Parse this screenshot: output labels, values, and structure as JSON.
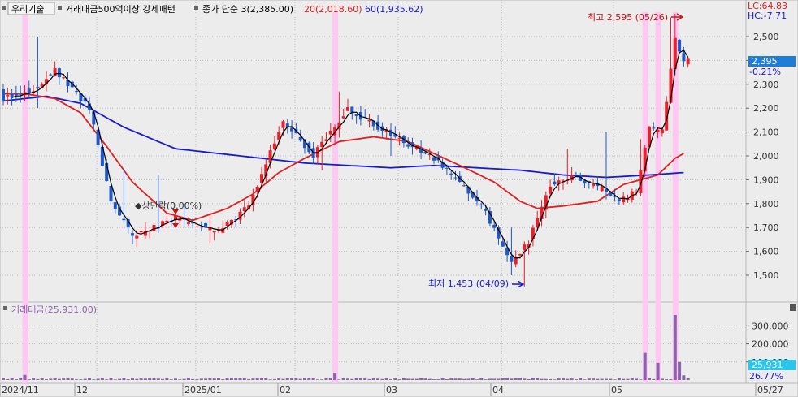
{
  "header": {
    "stock_name": "우리기술",
    "study_name": "거래대금500억이상 강세패턴",
    "close_label": "종가 단순 3(2,385.00)",
    "ma20_label": "20(2,018.60)",
    "ma60_label": "60(1,935.62)"
  },
  "lc_label": "LC:64.83",
  "hc_label": "HC:-7.71",
  "annotations": {
    "high": "최고 2,595 (05/26)",
    "low": "최저 1,453 (04/09)",
    "marker": "◆상단락(0.00%)"
  },
  "current": {
    "price": "2,395",
    "change": "-0.21%"
  },
  "volume_panel": {
    "title": "거래대금(25,931.00)",
    "current_value": "25,931",
    "current_pct": "26.77%",
    "ticks": [
      "300,000",
      "200,000",
      "100,000"
    ]
  },
  "colors": {
    "up": "#e8202a",
    "down": "#1f58c8",
    "ma3": "#000000",
    "ma20": "#e02020",
    "ma60": "#1a1acd",
    "highlight": "#ffc8f2",
    "volume": "#8a64aa",
    "price_box": "#1f7dd8",
    "volume_box": "#2bc4ea"
  },
  "chart_data": {
    "type": "candlestick",
    "yticks": [
      "2,500",
      "2,400",
      "2,300",
      "2,200",
      "2,100",
      "2,000",
      "1,900",
      "1,800",
      "1,700",
      "1,600",
      "1,500"
    ],
    "ylim": [
      1400,
      2600
    ],
    "x_labels": [
      "2024/11",
      "12",
      "2025/01",
      "02",
      "03",
      "04",
      "05",
      "05/27"
    ],
    "series": [
      {
        "name": "종가 단순 3",
        "type": "line"
      },
      {
        "name": "20",
        "type": "line"
      },
      {
        "name": "60",
        "type": "line"
      }
    ],
    "ohlc_control": [
      [
        0,
        2260,
        2240
      ],
      [
        7,
        2170,
        2280
      ],
      [
        12,
        2340,
        2360
      ],
      [
        20,
        2250,
        2200
      ],
      [
        25,
        1900,
        1810
      ],
      [
        30,
        1650,
        1660
      ],
      [
        40,
        1760,
        1740
      ],
      [
        50,
        1640,
        1680
      ],
      [
        57,
        1790,
        1790
      ],
      [
        65,
        2100,
        2150
      ],
      [
        72,
        2060,
        2000
      ],
      [
        80,
        2080,
        2200
      ],
      [
        85,
        2180,
        2140
      ],
      [
        92,
        2050,
        2070
      ],
      [
        100,
        2000,
        1990
      ],
      [
        107,
        1960,
        1870
      ],
      [
        112,
        1790,
        1760
      ],
      [
        118,
        1640,
        1550
      ],
      [
        122,
        1520,
        1640
      ],
      [
        127,
        1850,
        1880
      ],
      [
        132,
        1960,
        1920
      ],
      [
        140,
        1980,
        1850
      ],
      [
        143,
        1880,
        1810
      ],
      [
        147,
        1830,
        1850
      ],
      [
        150,
        1960,
        2120
      ],
      [
        153,
        2200,
        2100
      ],
      [
        156,
        2250,
        2490
      ],
      [
        158,
        2380,
        2395
      ]
    ],
    "wicks": [
      [
        8,
        2500,
        2200
      ],
      [
        28,
        1950,
        1800
      ],
      [
        30,
        1670,
        1630
      ],
      [
        36,
        1920,
        1800
      ],
      [
        42,
        1800,
        1700
      ],
      [
        48,
        1760,
        1630
      ],
      [
        74,
        2020,
        1940
      ],
      [
        78,
        2270,
        2080
      ],
      [
        90,
        2100,
        2000
      ],
      [
        118,
        1700,
        1500
      ],
      [
        121,
        1560,
        1453
      ],
      [
        131,
        2030,
        1880
      ],
      [
        140,
        2100,
        1850
      ],
      [
        148,
        2070,
        1830
      ],
      [
        155,
        2580,
        2480
      ],
      [
        156,
        2595,
        2450
      ]
    ],
    "ma20": [
      [
        0,
        2260
      ],
      [
        5,
        2260
      ],
      [
        12,
        2240
      ],
      [
        18,
        2180
      ],
      [
        24,
        2040
      ],
      [
        30,
        1890
      ],
      [
        38,
        1760
      ],
      [
        44,
        1730
      ],
      [
        52,
        1780
      ],
      [
        58,
        1840
      ],
      [
        64,
        1930
      ],
      [
        70,
        1990
      ],
      [
        78,
        2060
      ],
      [
        86,
        2080
      ],
      [
        94,
        2060
      ],
      [
        100,
        2010
      ],
      [
        106,
        1960
      ],
      [
        114,
        1890
      ],
      [
        120,
        1810
      ],
      [
        124,
        1780
      ],
      [
        130,
        1790
      ],
      [
        138,
        1810
      ],
      [
        144,
        1880
      ],
      [
        148,
        1900
      ],
      [
        152,
        1920
      ],
      [
        156,
        1990
      ],
      [
        158,
        2010
      ]
    ],
    "ma60": [
      [
        0,
        2230
      ],
      [
        10,
        2250
      ],
      [
        18,
        2220
      ],
      [
        28,
        2120
      ],
      [
        40,
        2030
      ],
      [
        50,
        2010
      ],
      [
        60,
        1990
      ],
      [
        70,
        1970
      ],
      [
        80,
        1960
      ],
      [
        90,
        1950
      ],
      [
        100,
        1960
      ],
      [
        110,
        1950
      ],
      [
        120,
        1940
      ],
      [
        130,
        1920
      ],
      [
        140,
        1910
      ],
      [
        150,
        1920
      ],
      [
        158,
        1930
      ]
    ],
    "highlight_candles": [
      5,
      77,
      149,
      152,
      156
    ],
    "x_label_positions": [
      0,
      17,
      40,
      63,
      87,
      111,
      137
    ],
    "volume_spikes": [
      [
        5,
        28000
      ],
      [
        77,
        40000
      ],
      [
        149,
        150000
      ],
      [
        152,
        95000
      ],
      [
        156,
        360000
      ],
      [
        157,
        100000
      ],
      [
        158,
        25931
      ]
    ],
    "volume_ylim": [
      0,
      360000
    ]
  }
}
